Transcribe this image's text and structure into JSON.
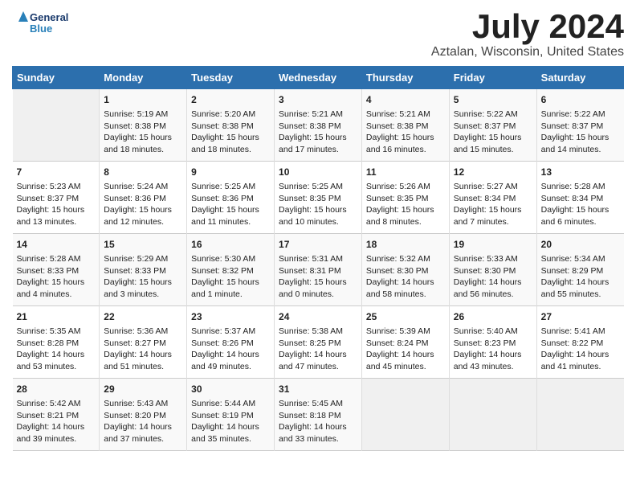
{
  "header": {
    "logo_line1": "General",
    "logo_line2": "Blue",
    "title": "July 2024",
    "subtitle": "Aztalan, Wisconsin, United States"
  },
  "days_of_week": [
    "Sunday",
    "Monday",
    "Tuesday",
    "Wednesday",
    "Thursday",
    "Friday",
    "Saturday"
  ],
  "weeks": [
    [
      {
        "day": "",
        "info": ""
      },
      {
        "day": "1",
        "info": "Sunrise: 5:19 AM\nSunset: 8:38 PM\nDaylight: 15 hours\nand 18 minutes."
      },
      {
        "day": "2",
        "info": "Sunrise: 5:20 AM\nSunset: 8:38 PM\nDaylight: 15 hours\nand 18 minutes."
      },
      {
        "day": "3",
        "info": "Sunrise: 5:21 AM\nSunset: 8:38 PM\nDaylight: 15 hours\nand 17 minutes."
      },
      {
        "day": "4",
        "info": "Sunrise: 5:21 AM\nSunset: 8:38 PM\nDaylight: 15 hours\nand 16 minutes."
      },
      {
        "day": "5",
        "info": "Sunrise: 5:22 AM\nSunset: 8:37 PM\nDaylight: 15 hours\nand 15 minutes."
      },
      {
        "day": "6",
        "info": "Sunrise: 5:22 AM\nSunset: 8:37 PM\nDaylight: 15 hours\nand 14 minutes."
      }
    ],
    [
      {
        "day": "7",
        "info": "Sunrise: 5:23 AM\nSunset: 8:37 PM\nDaylight: 15 hours\nand 13 minutes."
      },
      {
        "day": "8",
        "info": "Sunrise: 5:24 AM\nSunset: 8:36 PM\nDaylight: 15 hours\nand 12 minutes."
      },
      {
        "day": "9",
        "info": "Sunrise: 5:25 AM\nSunset: 8:36 PM\nDaylight: 15 hours\nand 11 minutes."
      },
      {
        "day": "10",
        "info": "Sunrise: 5:25 AM\nSunset: 8:35 PM\nDaylight: 15 hours\nand 10 minutes."
      },
      {
        "day": "11",
        "info": "Sunrise: 5:26 AM\nSunset: 8:35 PM\nDaylight: 15 hours\nand 8 minutes."
      },
      {
        "day": "12",
        "info": "Sunrise: 5:27 AM\nSunset: 8:34 PM\nDaylight: 15 hours\nand 7 minutes."
      },
      {
        "day": "13",
        "info": "Sunrise: 5:28 AM\nSunset: 8:34 PM\nDaylight: 15 hours\nand 6 minutes."
      }
    ],
    [
      {
        "day": "14",
        "info": "Sunrise: 5:28 AM\nSunset: 8:33 PM\nDaylight: 15 hours\nand 4 minutes."
      },
      {
        "day": "15",
        "info": "Sunrise: 5:29 AM\nSunset: 8:33 PM\nDaylight: 15 hours\nand 3 minutes."
      },
      {
        "day": "16",
        "info": "Sunrise: 5:30 AM\nSunset: 8:32 PM\nDaylight: 15 hours\nand 1 minute."
      },
      {
        "day": "17",
        "info": "Sunrise: 5:31 AM\nSunset: 8:31 PM\nDaylight: 15 hours\nand 0 minutes."
      },
      {
        "day": "18",
        "info": "Sunrise: 5:32 AM\nSunset: 8:30 PM\nDaylight: 14 hours\nand 58 minutes."
      },
      {
        "day": "19",
        "info": "Sunrise: 5:33 AM\nSunset: 8:30 PM\nDaylight: 14 hours\nand 56 minutes."
      },
      {
        "day": "20",
        "info": "Sunrise: 5:34 AM\nSunset: 8:29 PM\nDaylight: 14 hours\nand 55 minutes."
      }
    ],
    [
      {
        "day": "21",
        "info": "Sunrise: 5:35 AM\nSunset: 8:28 PM\nDaylight: 14 hours\nand 53 minutes."
      },
      {
        "day": "22",
        "info": "Sunrise: 5:36 AM\nSunset: 8:27 PM\nDaylight: 14 hours\nand 51 minutes."
      },
      {
        "day": "23",
        "info": "Sunrise: 5:37 AM\nSunset: 8:26 PM\nDaylight: 14 hours\nand 49 minutes."
      },
      {
        "day": "24",
        "info": "Sunrise: 5:38 AM\nSunset: 8:25 PM\nDaylight: 14 hours\nand 47 minutes."
      },
      {
        "day": "25",
        "info": "Sunrise: 5:39 AM\nSunset: 8:24 PM\nDaylight: 14 hours\nand 45 minutes."
      },
      {
        "day": "26",
        "info": "Sunrise: 5:40 AM\nSunset: 8:23 PM\nDaylight: 14 hours\nand 43 minutes."
      },
      {
        "day": "27",
        "info": "Sunrise: 5:41 AM\nSunset: 8:22 PM\nDaylight: 14 hours\nand 41 minutes."
      }
    ],
    [
      {
        "day": "28",
        "info": "Sunrise: 5:42 AM\nSunset: 8:21 PM\nDaylight: 14 hours\nand 39 minutes."
      },
      {
        "day": "29",
        "info": "Sunrise: 5:43 AM\nSunset: 8:20 PM\nDaylight: 14 hours\nand 37 minutes."
      },
      {
        "day": "30",
        "info": "Sunrise: 5:44 AM\nSunset: 8:19 PM\nDaylight: 14 hours\nand 35 minutes."
      },
      {
        "day": "31",
        "info": "Sunrise: 5:45 AM\nSunset: 8:18 PM\nDaylight: 14 hours\nand 33 minutes."
      },
      {
        "day": "",
        "info": ""
      },
      {
        "day": "",
        "info": ""
      },
      {
        "day": "",
        "info": ""
      }
    ]
  ]
}
